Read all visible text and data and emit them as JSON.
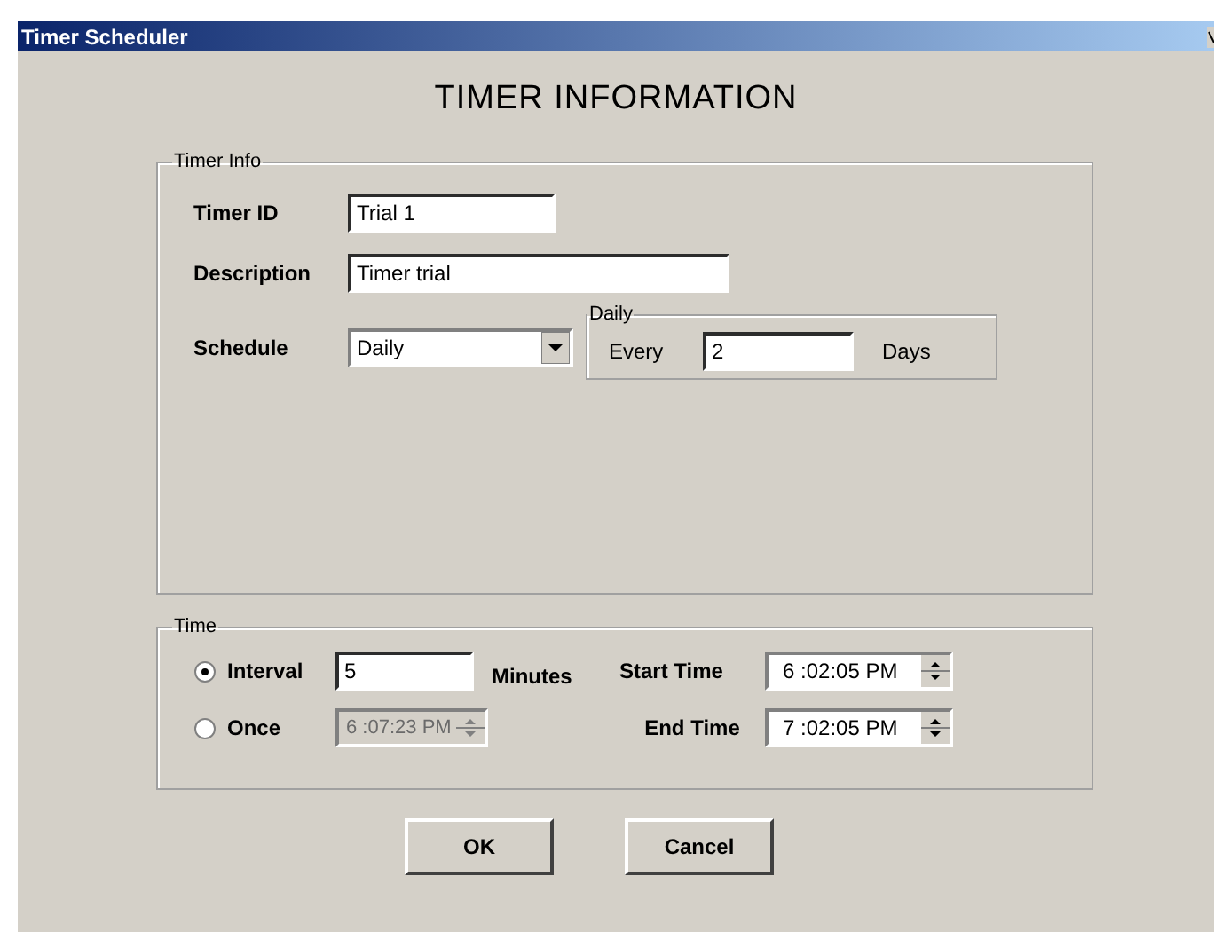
{
  "window": {
    "title": "Timer Scheduler"
  },
  "heading": "TIMER INFORMATION",
  "timer_info": {
    "legend": "Timer Info",
    "fields": [
      {
        "label": "Timer ID",
        "value": "Trial 1"
      },
      {
        "label": "Description",
        "value": "Timer trial"
      }
    ],
    "schedule": {
      "label": "Schedule",
      "value": "Daily"
    },
    "daily": {
      "legend": "Daily",
      "prefix": "Every",
      "value": "2",
      "suffix": "Days"
    }
  },
  "time": {
    "legend": "Time",
    "modes": [
      {
        "label": "Interval",
        "selected": true
      },
      {
        "label": "Once",
        "selected": false
      }
    ],
    "interval": {
      "value": "5",
      "unit": "Minutes"
    },
    "once": {
      "value": "6 :07:23 PM",
      "disabled": true
    },
    "times": [
      {
        "label": "Start Time",
        "value": "6 :02:05 PM"
      },
      {
        "label": "End Time",
        "value": "7 :02:05 PM"
      }
    ]
  },
  "buttons": [
    "OK",
    "Cancel"
  ]
}
